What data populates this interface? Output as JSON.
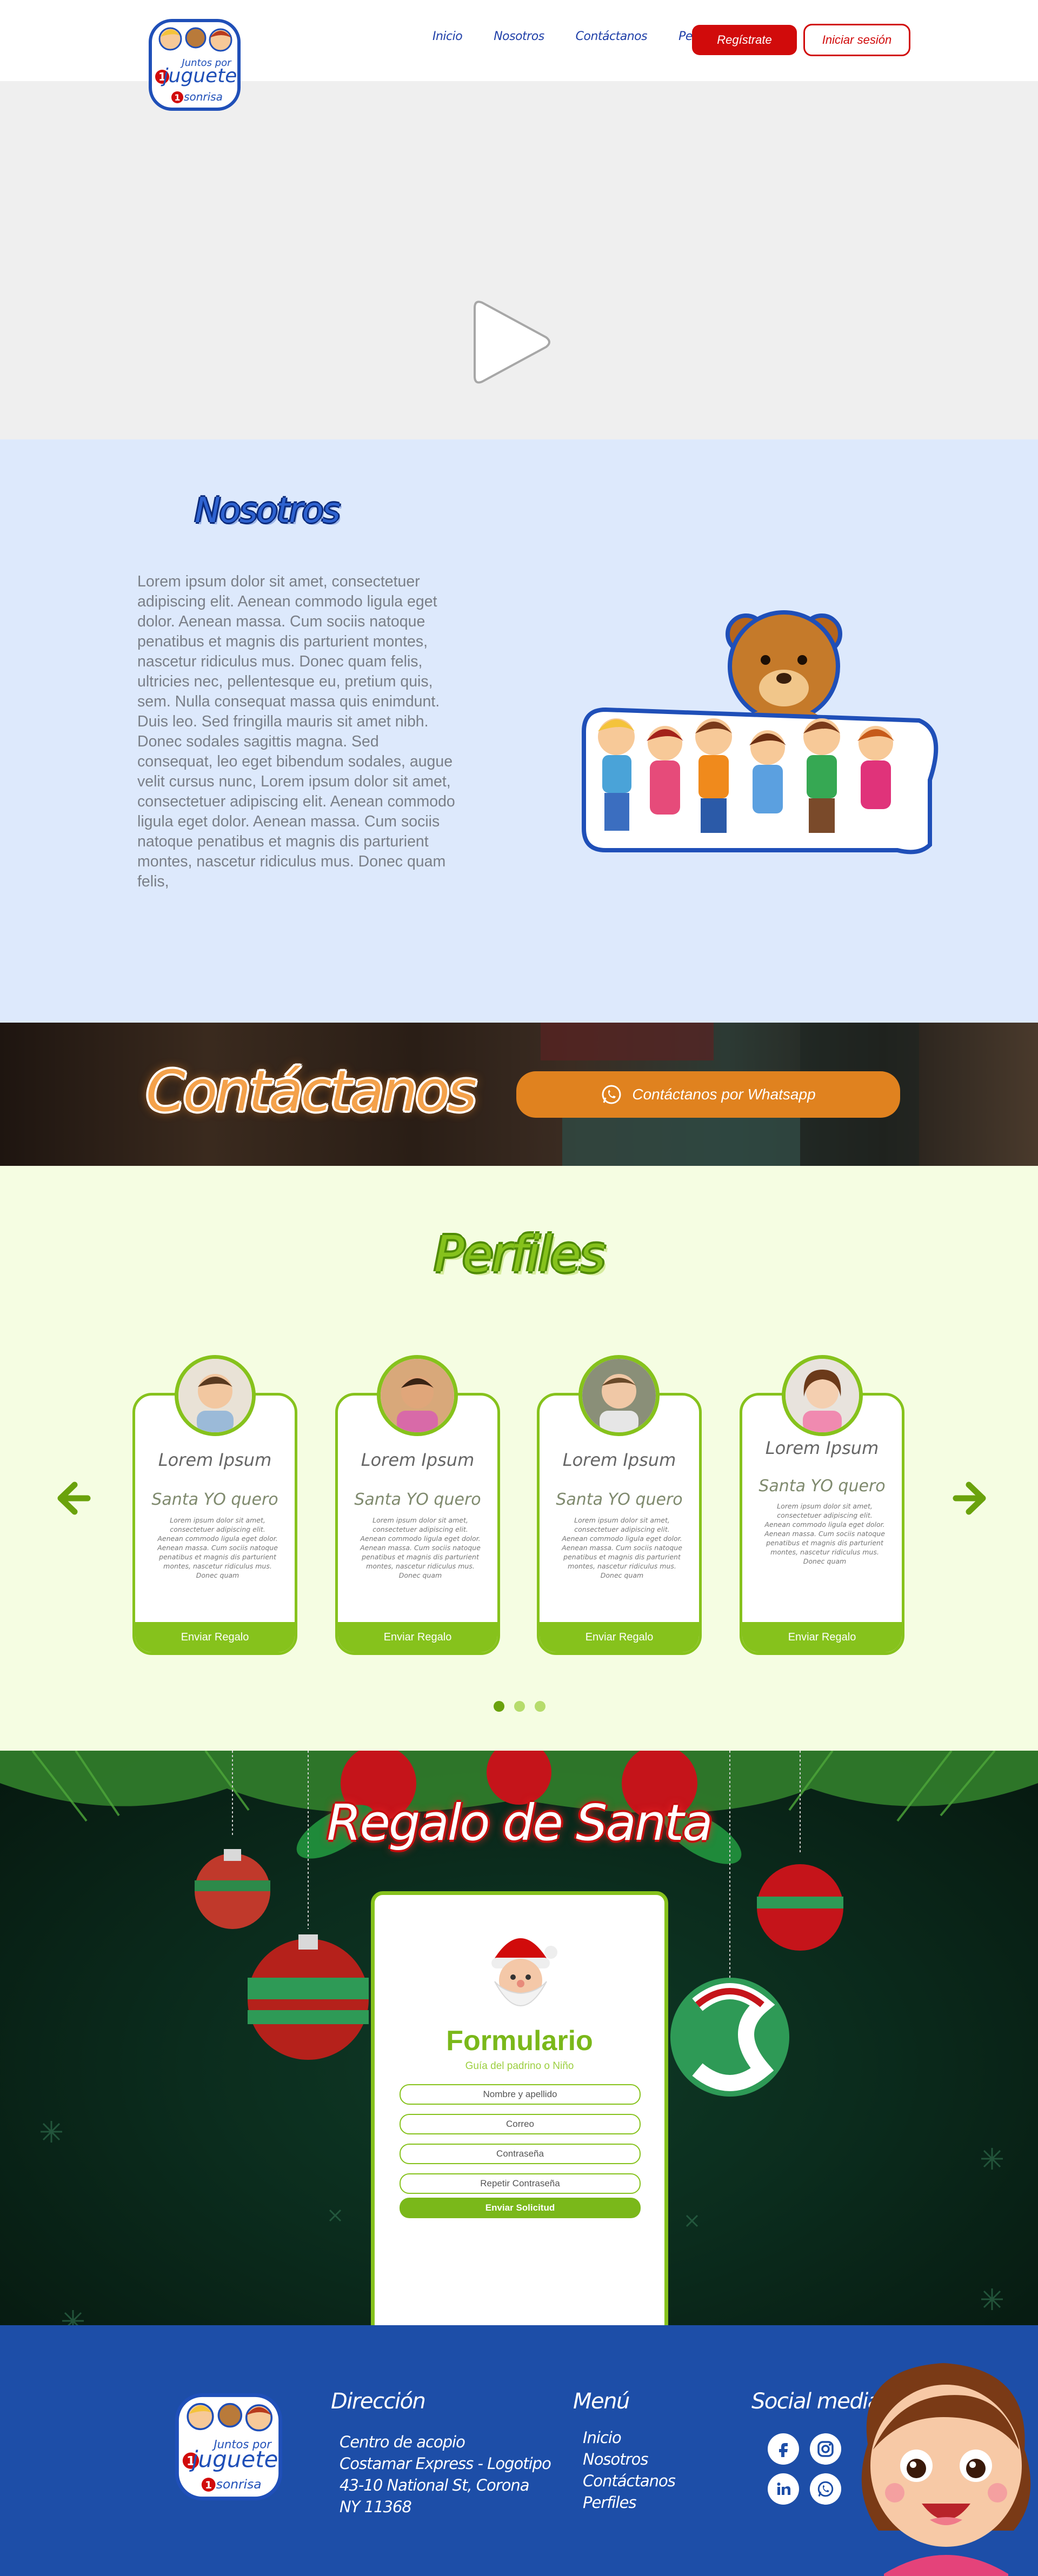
{
  "header": {
    "nav": [
      "Inicio",
      "Nosotros",
      "Contáctanos",
      "Perfiles"
    ],
    "register_label": "Regístrate",
    "login_label": "Iniciar sesión",
    "logo_text": [
      "Juntos por",
      "1",
      "juguete",
      "1",
      "sonrisa"
    ]
  },
  "video": {
    "icon": "play-icon"
  },
  "nosotros": {
    "title": "Nosotros",
    "body": "Lorem ipsum dolor sit amet, consectetuer adipiscing elit. Aenean commodo ligula eget dolor. Aenean massa. Cum sociis natoque penatibus et magnis dis parturient montes, nascetur ridiculus mus. Donec quam felis, ultricies nec, pellentesque eu, pretium quis, sem. Nulla consequat massa quis enimdunt. Duis leo. Sed fringilla mauris sit amet nibh. Donec sodales sagittis magna. Sed consequat, leo eget bibendum sodales, augue velit cursus nunc, Lorem ipsum dolor sit amet, consectetuer adipiscing elit. Aenean commodo ligula eget dolor. Aenean massa. Cum sociis natoque penatibus et magnis dis parturient montes, nascetur ridiculus mus. Donec quam felis,"
  },
  "contact": {
    "title": "Contáctanos",
    "whatsapp_label": "Contáctanos por Whatsapp",
    "icon": "whatsapp-icon"
  },
  "perfiles": {
    "title": "Perfiles",
    "cards": [
      {
        "name": "Lorem Ipsum",
        "wish": "Santa YO quero",
        "desc": "Lorem ipsum dolor sit amet, consectetuer adipiscing elit. Aenean commodo ligula eget dolor. Aenean massa. Cum sociis natoque penatibus et magnis dis parturient montes, nascetur ridiculus mus. Donec quam",
        "button": "Enviar Regalo"
      },
      {
        "name": "Lorem Ipsum",
        "wish": "Santa YO quero",
        "desc": "Lorem ipsum dolor sit amet, consectetuer adipiscing elit. Aenean commodo ligula eget dolor. Aenean massa. Cum sociis natoque penatibus et magnis dis parturient montes, nascetur ridiculus mus. Donec quam",
        "button": "Enviar Regalo"
      },
      {
        "name": "Lorem Ipsum",
        "wish": "Santa YO quero",
        "desc": "Lorem ipsum dolor sit amet, consectetuer adipiscing elit. Aenean commodo ligula eget dolor. Aenean massa. Cum sociis natoque penatibus et magnis dis parturient montes, nascetur ridiculus mus. Donec quam",
        "button": "Enviar Regalo"
      },
      {
        "name": "Lorem Ipsum",
        "wish": "Santa YO quero",
        "desc": "Lorem ipsum dolor sit amet, consectetuer adipiscing elit. Aenean commodo ligula eget dolor. Aenean massa. Cum sociis natoque penatibus et magnis dis parturient montes, nascetur ridiculus mus. Donec quam",
        "button": "Enviar Regalo"
      }
    ],
    "prev_icon": "arrow-left-icon",
    "next_icon": "arrow-right-icon",
    "pagination": {
      "count": 3,
      "active": 1
    }
  },
  "regalo": {
    "title": "Regalo de Santa",
    "form_title": "Formulario",
    "form_subtitle": "Guía del padrino o Niño",
    "placeholders": [
      "Nombre y apellido",
      "Correo",
      "Contraseña",
      "Repetir Contraseña"
    ],
    "submit_label": "Enviar Solicitud"
  },
  "footer": {
    "address_title": "Dirección",
    "address_lines": [
      "Centro de acopio",
      "Costamar Express - Logotipo",
      "43-10 National St, Corona",
      "NY 11368"
    ],
    "menu_title": "Menú",
    "menu_items": [
      "Inicio",
      "Nosotros",
      "Contáctanos",
      "Perfiles"
    ],
    "social_title": "Social media",
    "social_icons": [
      "facebook-icon",
      "instagram-icon",
      "linkedin-icon",
      "whatsapp-icon"
    ]
  },
  "colors": {
    "brand_red": "#d10b0b",
    "brand_green": "#86c21c",
    "brand_blue": "#1d4ea8",
    "orange": "#e0821f",
    "nosotros_bg": "#dde9fc",
    "perfiles_bg": "#f5fde2"
  }
}
